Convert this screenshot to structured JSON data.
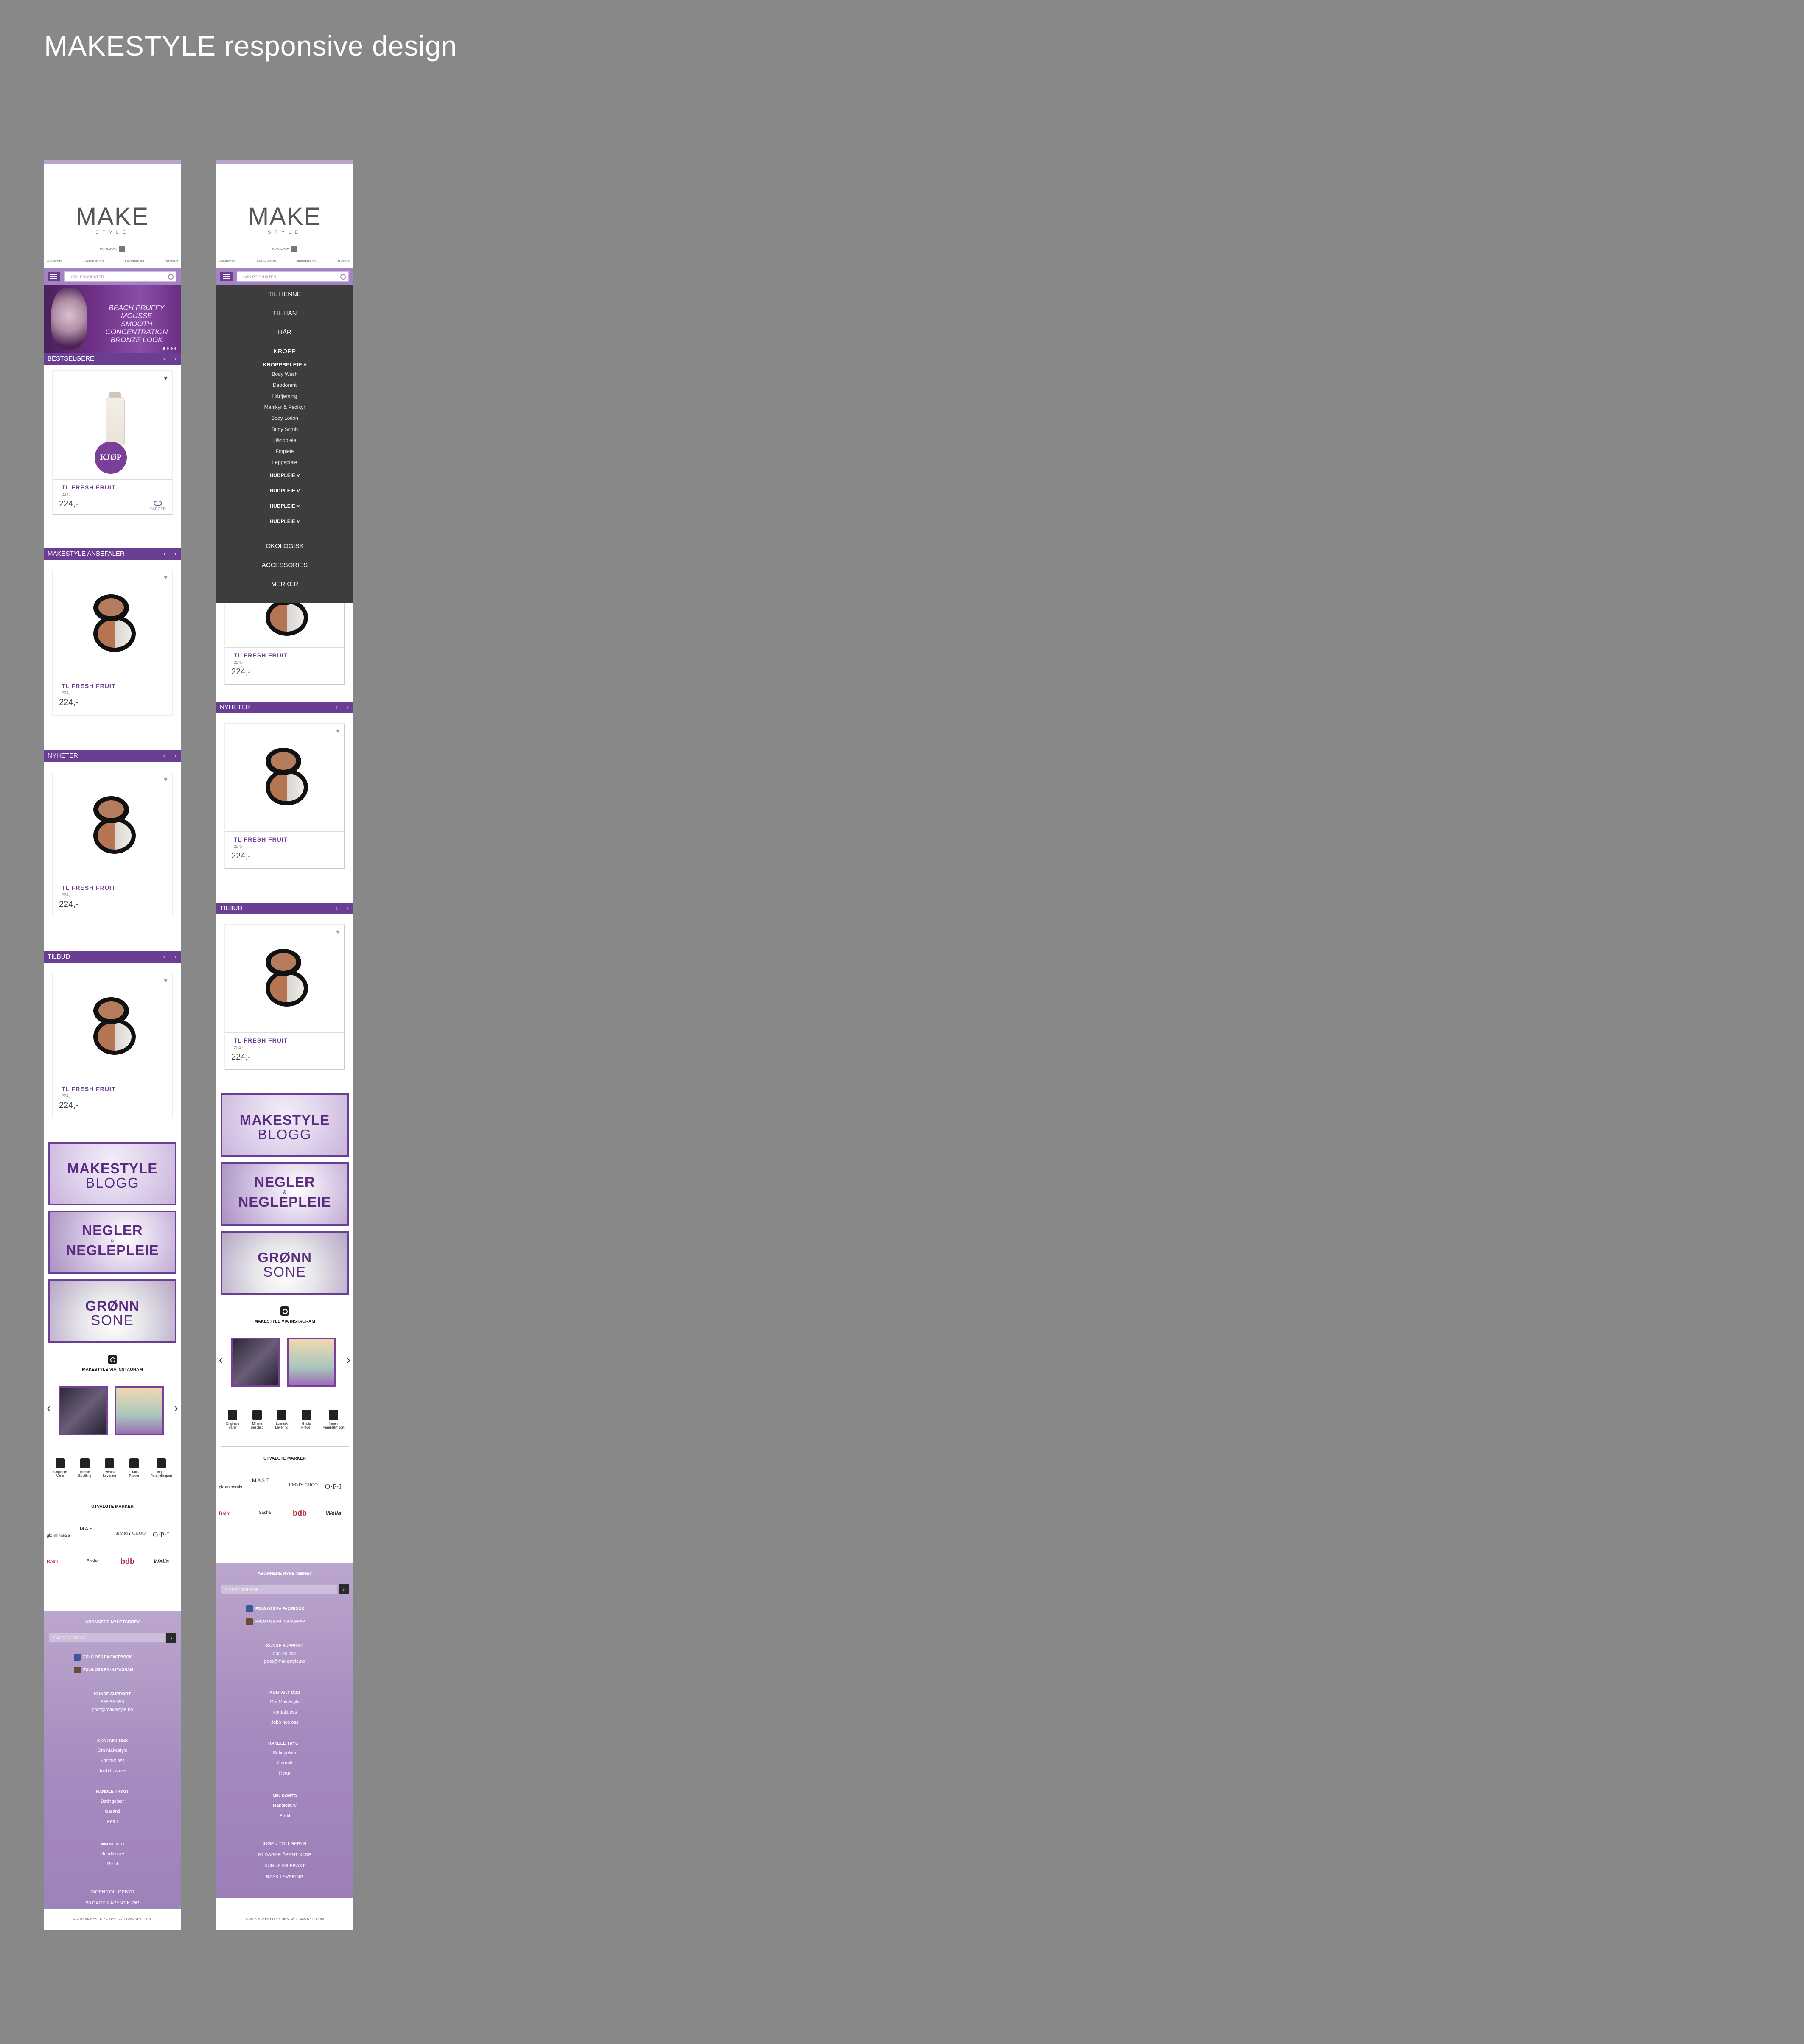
{
  "page_title": "MAKESTYLE responsive design",
  "header": {
    "logo_main": "MAKE",
    "logo_sub": "STYLE",
    "cart_label": "HANDLEKURV",
    "usps": [
      "KLAGERETTEN",
      "LOGG INN MIN SIDE",
      "REGISTRERE DEG",
      "TA KONTAKT"
    ],
    "search_placeholder": "SØK PRODUKTER ..."
  },
  "hero": {
    "line1": "BEACH PRUFFY MOUSSE",
    "line2": "SMOOTH CONCENTRATION",
    "line3": "BRONZE LOOK"
  },
  "sections": {
    "bestsellers": "BESTSELGERE",
    "recommended": "MAKESTYLE ANBEFALER",
    "news": "NYHETER",
    "offers": "TILBUD"
  },
  "product": {
    "name": "TL FRESH FRUIT",
    "old_price": "224,-",
    "price": "224,-",
    "buy_label": "KJØP",
    "colors_label": "FARGER"
  },
  "blog_banners": [
    {
      "line1": "MAKESTYLE",
      "line2": "BLOGG"
    },
    {
      "line1": "NEGLER",
      "amp": "&",
      "line2": "NEGLEPLEIE"
    },
    {
      "line1": "GRØNN",
      "line2": "SONE"
    }
  ],
  "instagram": {
    "title": "MAKESTYLE VIA INSTAGRAM"
  },
  "usp_icons": [
    {
      "l1": "Originale",
      "l2": "Varer",
      "icon": "tag-icon"
    },
    {
      "l1": "Minste",
      "l2": "Bestiling",
      "icon": "lock-icon"
    },
    {
      "l1": "Lynrask",
      "l2": "Levering",
      "icon": "truck-icon"
    },
    {
      "l1": "Gratis",
      "l2": "Prøver",
      "icon": "gift-icon"
    },
    {
      "l1": "Ingen",
      "l2": "Parallellimport",
      "icon": "shield-icon"
    }
  ],
  "brands": {
    "title": "UTVALGTE MARKER",
    "list": [
      "glo•minerals",
      "MAST",
      "JIMMY CHOO",
      "O·P·I",
      "Balm",
      "Sasha",
      "bdb",
      "Wella"
    ]
  },
  "footer": {
    "newsletter_title": "ABONNERE NYHETSBREV",
    "email_placeholder": "E-POST ADRESSE",
    "submit_label": "›",
    "facebook": "FØLG OSS PÅ FACEBOOK",
    "instagram": "FØLG OSS PÅ INSTAGRAM",
    "support_title": "KUNDE SUPPORT",
    "phone": "555 55 555",
    "email": "post@makestyle.no",
    "contact_title": "KONTAKT OSS",
    "contact_links": [
      "Om Makestyle",
      "Kontakt oss",
      "Jobb hos oss"
    ],
    "trust_title": "HANDLE TRYGT",
    "trust_links": [
      "Betingelser",
      "Garanti",
      "Retur"
    ],
    "account_title": "MIN KONTO",
    "account_links": [
      "Handlekurv",
      "Profil"
    ],
    "promises": [
      "INGEN TOLLGEBYR",
      "90 DAGER ÅPENT KJØP",
      "KUN 49 KR FRAKT",
      "RASK LEVERING"
    ],
    "copyright": "© 2013 MAKESTYLE // DESIGN + CMS NETFORM"
  },
  "menu": {
    "top": [
      "TIL HENNE",
      "TIL HAN",
      "HÅR",
      "KROPP"
    ],
    "open_group": "KROPPSPLEIE",
    "open_items": [
      "Body Wash",
      "Deodorant",
      "Hårfjerning",
      "Manikyr & Pedikyr",
      "Body Lotion",
      "Body Scrub",
      "Håndpleie",
      "Fotpleie",
      "Leppepleie"
    ],
    "collapsed_groups": [
      "HUDPLEIE",
      "HUDPLEIE",
      "HUDPLEIE",
      "HUDPLEIE"
    ],
    "bottom": [
      "OKOLOGISK",
      "ACCESSORIES",
      "MERKER"
    ]
  }
}
